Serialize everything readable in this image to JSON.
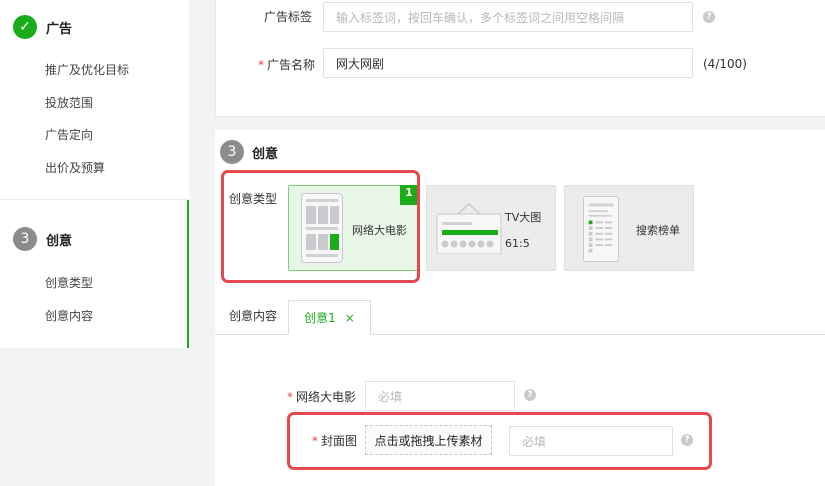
{
  "sidebar": {
    "section1": {
      "number": "✓",
      "title": "广告",
      "items": [
        "推广及优化目标",
        "投放范围",
        "广告定向",
        "出价及预算"
      ]
    },
    "section2": {
      "number": "3",
      "title": "创意",
      "items": [
        "创意类型",
        "创意内容"
      ]
    }
  },
  "ad_form": {
    "tag_label": "广告标签",
    "tag_placeholder": "输入标签词，按回车确认，多个标签词之间用空格间隔",
    "name_label": "广告名称",
    "name_value": "网大网剧",
    "name_counter": "(4/100)",
    "required_mark": "*",
    "help_icon_glyph": "?"
  },
  "creative": {
    "section_number": "3",
    "section_title": "创意",
    "type_label": "创意类型",
    "types": [
      {
        "label": "网络大电影",
        "selected": true,
        "badge": "1"
      },
      {
        "label": "TV大图",
        "sub": "61:5",
        "selected": false
      },
      {
        "label": "搜索榜单",
        "selected": false
      }
    ],
    "content_label": "创意内容",
    "tab_label": "创意1",
    "tab_close": "×",
    "fields": {
      "movie_label": "网络大电影",
      "movie_placeholder": "必填",
      "cover_label": "封面图",
      "upload_label": "点击或拖拽上传素材",
      "cover_placeholder": "必填"
    }
  },
  "colors": {
    "accent": "#1aad19",
    "highlight": "#e5484d",
    "required": "#e5484d"
  },
  "icons": [
    "check-icon",
    "question-icon",
    "close-icon",
    "web-movie-icon",
    "tv-image-icon",
    "search-rank-icon"
  ]
}
